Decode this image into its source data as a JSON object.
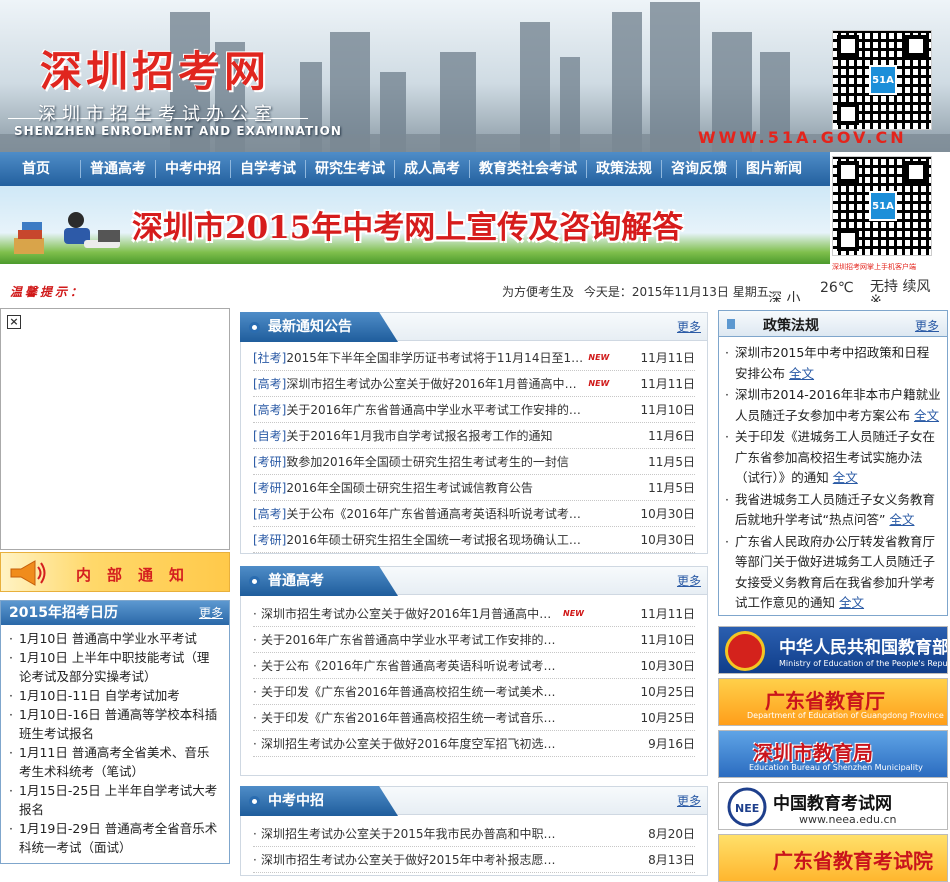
{
  "header": {
    "site_title": "深圳招考网",
    "office_name": "深圳市招生考试办公室",
    "office_en": "SHENZHEN ENROLMENT AND EXAMINATION",
    "site_url": "WWW.51A.GOV.CN",
    "qr_badge": "51A",
    "qr_caption": "深圳招考网掌上手机客户端"
  },
  "nav": {
    "items": [
      "首页",
      "普通高考",
      "中考中招",
      "自学考试",
      "研究生考试",
      "成人高考",
      "教育类社会考试",
      "政策法规",
      "咨询反馈",
      "图片新闻"
    ]
  },
  "banner": {
    "text": "深圳市2015年中考网上宣传及咨询解答"
  },
  "tip_bar": {
    "label": "温馨提示：",
    "ticker": "为方便考生及",
    "today": "今天是：2015年11月13日 星期五",
    "weather_city": "深 小",
    "weather_temp": "26℃",
    "weather_desc": "无持 续风 ※"
  },
  "left": {
    "close_label": "×",
    "notice_label": "内部通知",
    "calendar_title": "2015年招考日历",
    "calendar_more": "更多",
    "calendar_items": [
      "1月10日  普通高中学业水平考试",
      "1月10日  上半年中职技能考试（理论考试及部分实操考试）",
      "1月10日-11日  自学考试加考",
      "1月10日-16日  普通高等学校本科插班生考试报名",
      "1月11日  普通高考全省美术、音乐考生术科统考（笔试）",
      "1月15日-25日  上半年自学考试大考报名",
      "1月19日-29日  普通高考全省音乐术科统一考试（面试）"
    ]
  },
  "center": {
    "more_label": "更多",
    "new_badge": "NEW",
    "notices": {
      "title": "最新通知公告",
      "items": [
        {
          "cat": "[社考]",
          "title": "2015年下半年全国非学历证书考试将于11月14日至15日...",
          "new": true,
          "date": "11月11日"
        },
        {
          "cat": "[高考]",
          "title": "深圳市招生考试办公室关于做好2016年1月普通高中学业...",
          "new": true,
          "date": "11月11日"
        },
        {
          "cat": "[高考]",
          "title": "关于2016年广东省普通高中学业水平考试工作安排的通...",
          "new": false,
          "date": "11月10日"
        },
        {
          "cat": "[自考]",
          "title": "关于2016年1月我市自学考试报名报考工作的通知",
          "new": false,
          "date": "11月6日"
        },
        {
          "cat": "[考研]",
          "title": "致参加2016年全国硕士研究生招生考试考生的一封信",
          "new": false,
          "date": "11月5日"
        },
        {
          "cat": "[考研]",
          "title": "2016年全国硕士研究生招生考试诚信教育公告",
          "new": false,
          "date": "11月5日"
        },
        {
          "cat": "[高考]",
          "title": "关于公布《2016年广东省普通高考英语科听说考试考试...",
          "new": false,
          "date": "10月30日"
        },
        {
          "cat": "[考研]",
          "title": "2016年硕士研究生招生全国统一考试报名现场确认工作...",
          "new": false,
          "date": "10月30日"
        }
      ]
    },
    "gaokao": {
      "title": "普通高考",
      "items": [
        {
          "title": "深圳市招生考试办公室关于做好2016年1月普通高中学业水平...",
          "new": true,
          "date": "11月11日"
        },
        {
          "title": "关于2016年广东省普通高中学业水平考试工作安排的通知",
          "new": false,
          "date": "11月10日"
        },
        {
          "title": "关于公布《2016年广东省普通高考英语科听说考试考试大纲...",
          "new": false,
          "date": "10月30日"
        },
        {
          "title": "关于印发《广东省2016年普通高校招生统一考试美术术科考...",
          "new": false,
          "date": "10月25日"
        },
        {
          "title": "关于印发《广东省2016年普通高校招生统一考试音乐术科考...",
          "new": false,
          "date": "10月25日"
        },
        {
          "title": "深圳招生考试办公室关于做好2016年度空军招飞初选检测工...",
          "new": false,
          "date": "9月16日"
        }
      ]
    },
    "zhongkao": {
      "title": "中考中招",
      "items": [
        {
          "title": "深圳招生考试办公室关于2015年我市民办普高和中职学校...",
          "new": false,
          "date": "8月20日"
        },
        {
          "title": "深圳市招生考试办公室关于做好2015年中考补报志愿和补录...",
          "new": false,
          "date": "8月13日"
        }
      ]
    }
  },
  "right": {
    "policy_title": "政策法规",
    "policy_more": "更多",
    "policy_full_label": "全文",
    "policy_items": [
      "深圳市2015年中考中招政策和日程安排公布",
      "深圳市2014-2016年非本市户籍就业人员随迁子女参加中考方案公布",
      "关于印发《进城务工人员随迁子女在广东省参加高校招生考试实施办法（试行）》的通知",
      "我省进城务工人员随迁子女义务教育后就地升学考试“热点问答”",
      "广东省人民政府办公厅转发省教育厅等部门关于做好进城务工人员随迁子女接受义务教育后在我省参加升学考试工作意见的通知"
    ],
    "links": [
      {
        "main": "中华人民共和国教育部",
        "sub": "Ministry of Education of the People's Republic of China"
      },
      {
        "main": "广东省教育厅",
        "sub": "Department of Education of Guangdong Province"
      },
      {
        "main": "深圳市教育局",
        "sub": "Education Bureau of Shenzhen Municipality"
      },
      {
        "main": "中国教育考试网",
        "sub": "www.neea.edu.cn"
      },
      {
        "main": "广东省教育考试院",
        "sub": ""
      }
    ]
  }
}
